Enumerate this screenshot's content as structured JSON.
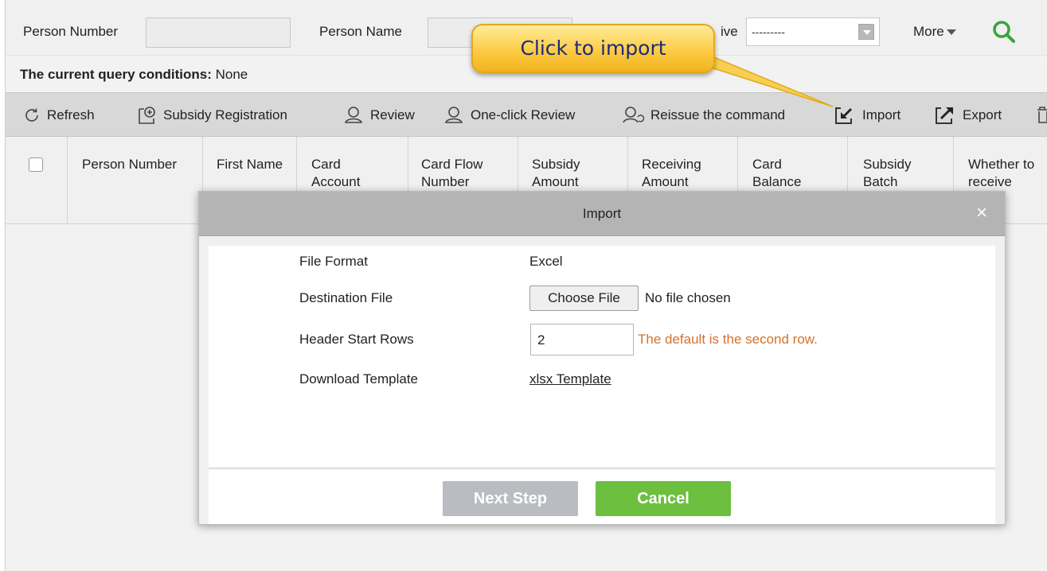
{
  "query": {
    "person_number_label": "Person Number",
    "person_name_label": "Person Name",
    "receive_label_partial": "ive",
    "receive_select_value": "---------",
    "more_label": "More",
    "conditions_label": "The current query conditions:",
    "conditions_value": "None"
  },
  "toolbar": {
    "refresh": "Refresh",
    "subsidy_registration": "Subsidy Registration",
    "review": "Review",
    "one_click_review": "One-click Review",
    "reissue": "Reissue the command",
    "import": "Import",
    "export": "Export"
  },
  "grid": {
    "columns": [
      [
        "Person Number"
      ],
      [
        "First Name"
      ],
      [
        "Card",
        "Account"
      ],
      [
        "Card Flow",
        "Number"
      ],
      [
        "Subsidy",
        "Amount"
      ],
      [
        "Receiving",
        "Amount"
      ],
      [
        "Card",
        "Balance"
      ],
      [
        "Subsidy",
        "Batch"
      ],
      [
        "Whether to",
        "receive"
      ]
    ]
  },
  "callout": {
    "text": "Click to import"
  },
  "modal": {
    "title": "Import",
    "close_glyph": "×",
    "file_format_label": "File Format",
    "file_format_value": "Excel",
    "destination_label": "Destination File",
    "choose_file_button": "Choose File",
    "no_file_text": "No file chosen",
    "header_rows_label": "Header Start Rows",
    "header_rows_value": "2",
    "header_rows_hint": "The default is the second row.",
    "download_label": "Download Template",
    "template_link": "xlsx Template",
    "next_button": "Next Step",
    "cancel_button": "Cancel"
  },
  "colors": {
    "accent_green": "#6dbf3f",
    "hint_orange": "#d5722b",
    "callout_yellow": "#fbc93e",
    "callout_text": "#1f2a7a"
  },
  "icons": [
    "search-icon",
    "refresh-icon",
    "subsidy-registration-icon",
    "review-icon",
    "one-click-review-icon",
    "reissue-icon",
    "import-icon",
    "export-icon",
    "delete-icon",
    "close-icon",
    "chevron-down-icon"
  ]
}
